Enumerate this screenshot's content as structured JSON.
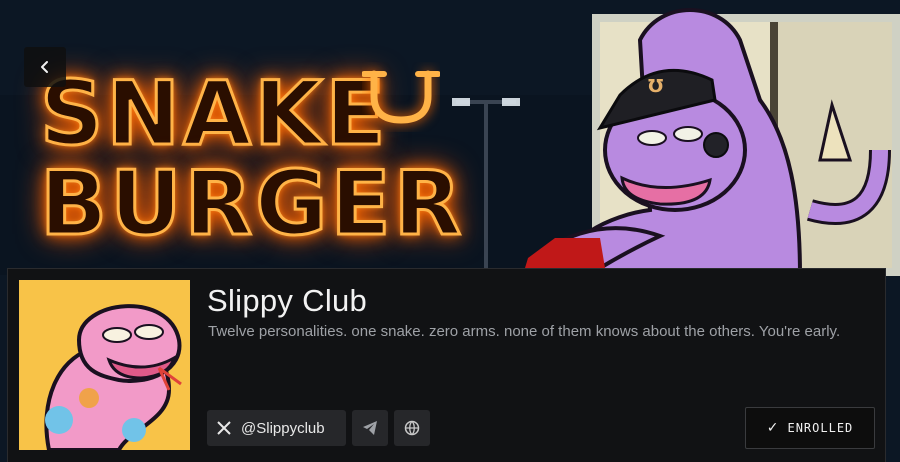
{
  "banner": {
    "sign_line_1": "SNAKE",
    "sign_line_2": "BURGER",
    "logo_letter": "Ʊ",
    "cap_logo": "Ʊ"
  },
  "nav": {
    "back_icon": "chevron-left-icon"
  },
  "profile": {
    "title": "Slippy Club",
    "tagline": "Twelve personalities. one snake. zero arms. none of them knows about the others. You're early.",
    "twitter_handle": "@Slippyclub",
    "enroll_label": "ENROLLED",
    "enroll_check": "✓"
  },
  "colors": {
    "neon_orange": "#ff8a1e",
    "snake_purple": "#b88ae0",
    "avatar_bg": "#f8c348",
    "card_bg": "#111214"
  }
}
